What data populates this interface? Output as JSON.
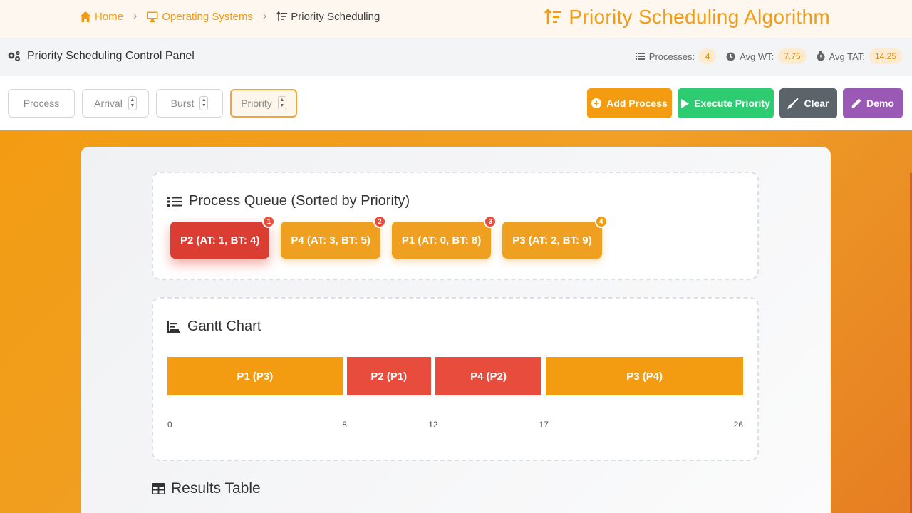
{
  "breadcrumb": [
    {
      "icon": "home-icon",
      "label": "Home"
    },
    {
      "icon": "desktop-icon",
      "label": "Operating Systems"
    },
    {
      "icon": "sort-icon",
      "label": "Priority Scheduling"
    }
  ],
  "header": {
    "title": "Priority Scheduling Algorithm",
    "icon": "sort-amount-icon"
  },
  "panel": {
    "title": "Priority Scheduling Control Panel",
    "stats": {
      "processes_label": "Processes:",
      "processes_value": "4",
      "avg_wt_label": "Avg WT:",
      "avg_wt_value": "7.75",
      "avg_tat_label": "Avg TAT:",
      "avg_tat_value": "14.25"
    }
  },
  "inputs": {
    "process_placeholder": "Process",
    "arrival_placeholder": "Arrival",
    "burst_placeholder": "Burst",
    "priority_placeholder": "Priority"
  },
  "buttons": {
    "add": "Add Process",
    "execute": "Execute Priority",
    "clear": "Clear",
    "demo": "Demo"
  },
  "colors": {
    "accent": "#f39c12",
    "high_priority": "#e74c3c",
    "execute": "#2ecc71",
    "clear": "#5b646b",
    "demo": "#9b59b6"
  },
  "queue": {
    "title": "Process Queue (Sorted by Priority)",
    "items": [
      {
        "label": "P2 (AT: 1, BT: 4)",
        "rank": "1"
      },
      {
        "label": "P4 (AT: 3, BT: 5)",
        "rank": "2"
      },
      {
        "label": "P1 (AT: 0, BT: 8)",
        "rank": "3"
      },
      {
        "label": "P3 (AT: 2, BT: 9)",
        "rank": "4"
      }
    ]
  },
  "gantt": {
    "title": "Gantt Chart",
    "blocks": [
      {
        "label": "P1 (P3)",
        "start": 0,
        "end": 8,
        "color": "#f39c12"
      },
      {
        "label": "P2 (P1)",
        "start": 8,
        "end": 12,
        "color": "#e74c3c"
      },
      {
        "label": "P4 (P2)",
        "start": 12,
        "end": 17,
        "color": "#e74c3c"
      },
      {
        "label": "P3 (P4)",
        "start": 17,
        "end": 26,
        "color": "#f39c12"
      }
    ],
    "ticks": [
      "0",
      "8",
      "12",
      "17",
      "26"
    ]
  },
  "results": {
    "title": "Results Table"
  }
}
